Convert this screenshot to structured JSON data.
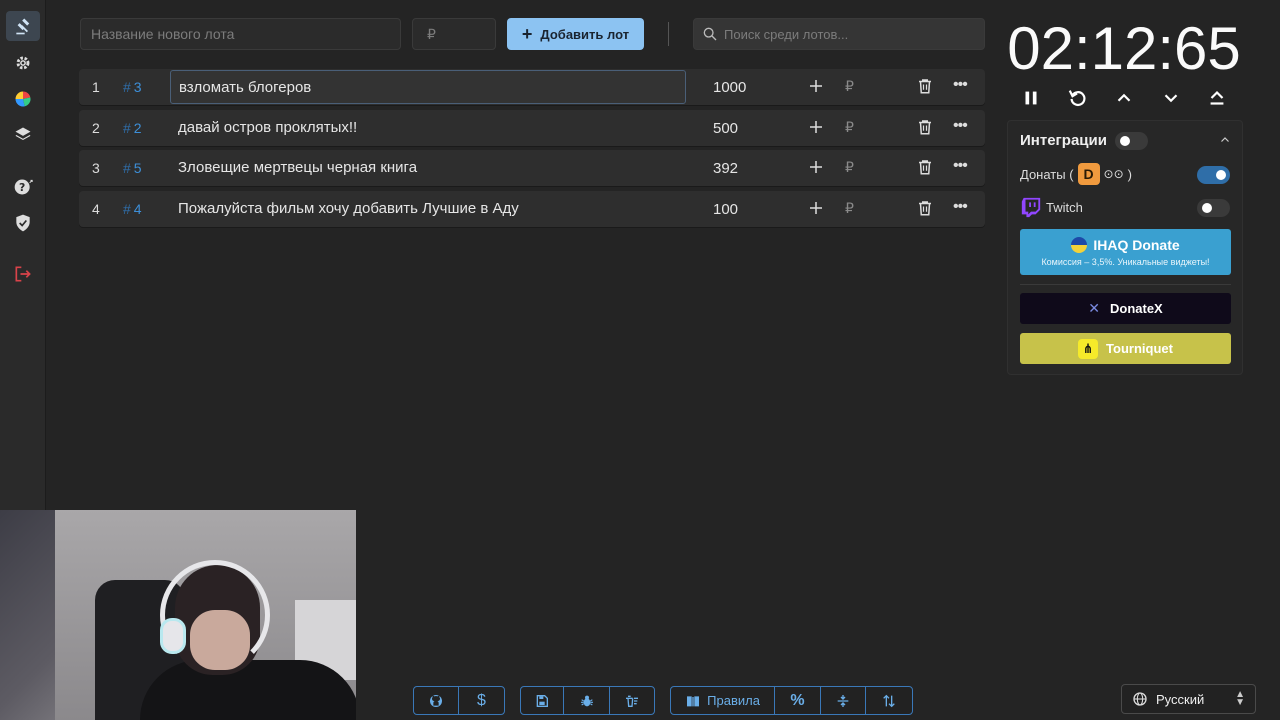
{
  "toolbar": {
    "name_placeholder": "Название нового лота",
    "price_placeholder": "₽",
    "add_label": "Добавить лот",
    "search_placeholder": "Поиск среди лотов..."
  },
  "lots": [
    {
      "num": "1",
      "id": "3",
      "name": "взломать блогеров",
      "amount": "1000",
      "currency": "₽"
    },
    {
      "num": "2",
      "id": "2",
      "name": "давай остров проклятых!!",
      "amount": "500",
      "currency": "₽"
    },
    {
      "num": "3",
      "id": "5",
      "name": "Зловещие мертвецы черная книга",
      "amount": "392",
      "currency": "₽"
    },
    {
      "num": "4",
      "id": "4",
      "name": "Пожалуйста фильм хочу добавить Лучшие в Аду",
      "amount": "100",
      "currency": "₽"
    }
  ],
  "timer": {
    "display": "02:12:65"
  },
  "integrations": {
    "title": "Интеграции",
    "enabled": false,
    "donations_label_pre": "Донаты (",
    "donations_label_post": ")",
    "donations_logo": "D",
    "donations_enabled": true,
    "twitch_label": "Twitch",
    "twitch_enabled": false,
    "ihaq_title": "IHAQ Donate",
    "ihaq_sub": "Комиссия – 3,5%. Уникальные виджеты!",
    "donatex_label": "DonateX",
    "tourniquet_label": "Tourniquet"
  },
  "bottom": {
    "rules_label": "Правила"
  },
  "language": {
    "selected": "Русский"
  },
  "colors": {
    "accent": "#8cc3f2",
    "link": "#3d8fd8",
    "ihaq": "#3aa0d0",
    "tourniquet": "#c7c24a",
    "logout": "#d9434a"
  }
}
